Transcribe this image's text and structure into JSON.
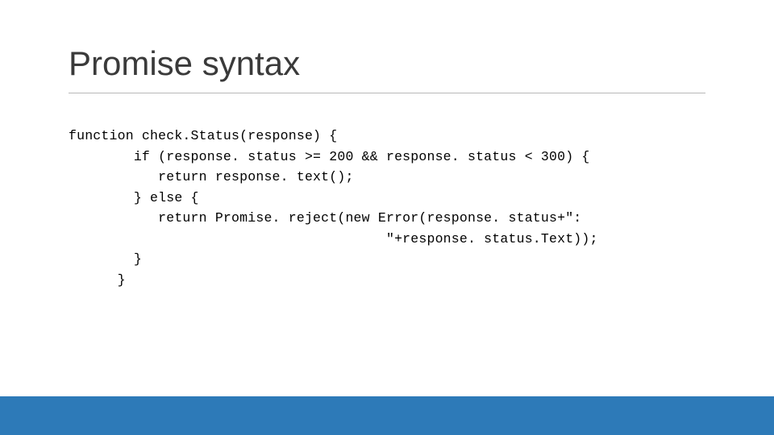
{
  "slide": {
    "title": "Promise syntax",
    "code": "function check.Status(response) {\n        if (response. status >= 200 && response. status < 300) {\n           return response. text();\n        } else {\n           return Promise. reject(new Error(response. status+\":\n                                       \"+response. status.Text));\n        }\n      }"
  }
}
